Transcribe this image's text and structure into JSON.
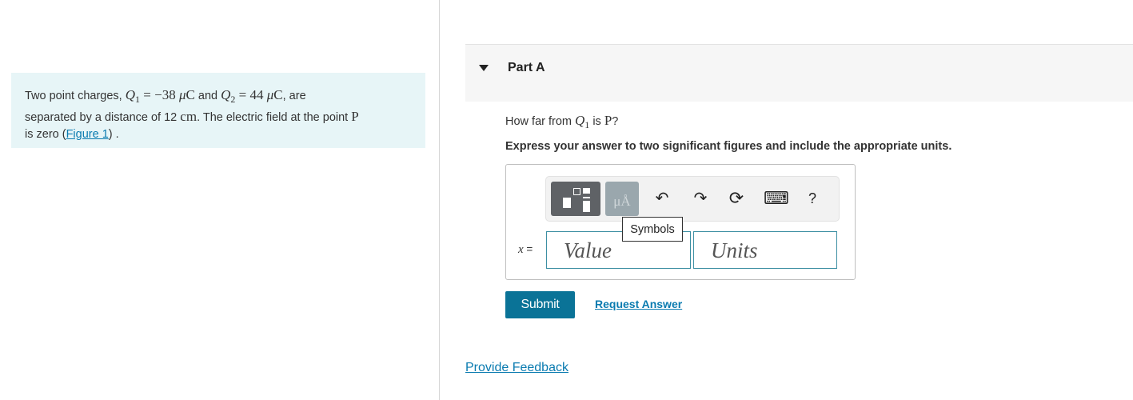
{
  "problem": {
    "line1_a": "Two point charges, ",
    "q1": "Q",
    "q1_sub": "1",
    "eq1": " = −38 ",
    "mu1": "μ",
    "c1": "C",
    "and": " and ",
    "q2": "Q",
    "q2_sub": "2",
    "eq2": " = 44 ",
    "mu2": "μ",
    "c2": "C",
    "are": ", are",
    "line2_a": "separated by a distance of 12 ",
    "cm": "cm",
    "line2_b": ". The electric field at the point ",
    "p": "P",
    "line3_a": "is zero (",
    "figure_link": "Figure 1",
    "line3_b": ") ."
  },
  "part": {
    "title": "Part A"
  },
  "question": {
    "prefix": "How far from ",
    "q": "Q",
    "q_sub": "1",
    "is": " is ",
    "p": "P",
    "suffix": "?"
  },
  "instruction": "Express your answer to two significant figures and include the appropriate units.",
  "toolbar": {
    "symbols_glyph": "μÅ",
    "undo_glyph": "↶",
    "redo_glyph": "↷",
    "reset_glyph": "⟳",
    "keyboard_glyph": "⌨",
    "help_glyph": "?",
    "tooltip": "Symbols"
  },
  "answer": {
    "variable": "x",
    "equals": " =",
    "value_placeholder": "Value",
    "units_placeholder": "Units"
  },
  "buttons": {
    "submit": "Submit",
    "request": "Request Answer"
  },
  "feedback": "Provide Feedback"
}
